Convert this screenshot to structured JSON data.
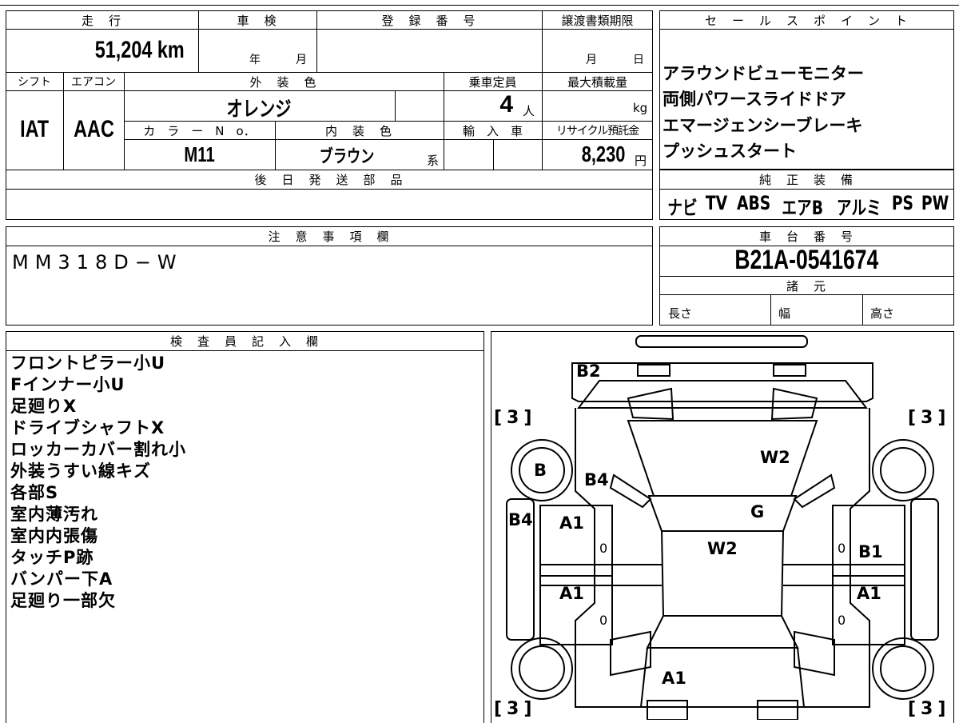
{
  "top": {
    "labels": {
      "mileage": "走　行",
      "inspection": "車　検",
      "registration": "登　録　番　号",
      "transfer_deadline": "譲渡書類期限",
      "shift": "シフト",
      "aircon": "エアコン",
      "exterior_color": "外　装　色",
      "capacity": "乗車定員",
      "max_load": "最大積載量",
      "color_no": "カ　ラ　ー　N　o．",
      "interior_color": "内　装　色",
      "import": "輸　入　車",
      "recycle": "リサイクル預託金",
      "later_parts": "後　日　発　送　部　品",
      "year": "年",
      "month": "月",
      "day": "日",
      "person": "人",
      "kg": "kg",
      "yen": "円",
      "series": "系"
    },
    "values": {
      "mileage": "51,204 km",
      "shift": "IAT",
      "aircon": "AAC",
      "exterior_color": "オレンジ",
      "capacity": "4",
      "color_no": "M11",
      "interior_color": "ブラウン",
      "recycle": "8,230"
    }
  },
  "sales_points": {
    "title": "セ　ー　ル　ス　ポ　イ　ン　ト",
    "items": [
      "アラウンドビューモニター",
      "両側パワースライドドア",
      "エマージェンシーブレーキ",
      "プッシュスタート"
    ]
  },
  "equipment": {
    "title": "純　正　装　備",
    "items": [
      "ナビ",
      "TV",
      "ABS",
      "エアB",
      "アルミ",
      "PS",
      "PW"
    ]
  },
  "notes": {
    "title": "注　意　事　項　欄",
    "text": "MM318D−W"
  },
  "chassis": {
    "title": "車　台　番　号",
    "number": "B21A-0541674"
  },
  "specs": {
    "title": "諸　元",
    "length": "長さ",
    "width": "幅",
    "height": "高さ"
  },
  "inspector": {
    "title": "検　査　員　記　入　欄",
    "lines": [
      "フロントピラー小U",
      "Fインナー小U",
      "足廻りX",
      "ドライブシャフトX",
      "ロッカーカバー割れ小",
      "外装うすい線キズ",
      "各部S",
      "室内薄汚れ",
      "室内内張傷",
      "タッチP跡",
      "バンパー下A",
      "足廻り一部欠"
    ]
  },
  "diagram": {
    "marks": {
      "b2": "B2",
      "b_left": "B",
      "b4_top": "B4",
      "w2_top": "W2",
      "g": "G",
      "b4_side": "B4",
      "a1_fl": "A1",
      "w2_mid": "W2",
      "b1": "B1",
      "a1_rl": "A1",
      "a1_rr": "A1",
      "a1_rear": "A1",
      "zero_1": "0",
      "zero_2": "0",
      "zero_3": "0",
      "zero_4": "0"
    },
    "brackets": [
      "[3]",
      "[3]",
      "[3]",
      "[3]"
    ]
  }
}
